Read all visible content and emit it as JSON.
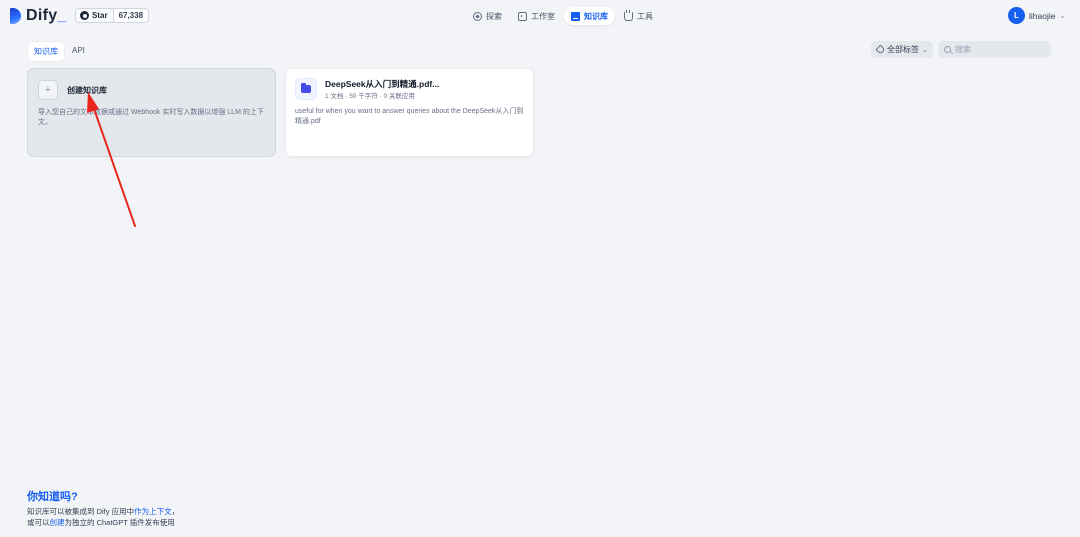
{
  "header": {
    "brand": "Dify",
    "brand_suffix": "_",
    "github": {
      "label": "Star",
      "count": "67,338"
    },
    "nav": [
      {
        "label": "探索",
        "icon": "compass-icon",
        "active": false
      },
      {
        "label": "工作室",
        "icon": "robot-icon",
        "active": false
      },
      {
        "label": "知识库",
        "icon": "book-icon",
        "active": true
      },
      {
        "label": "工具",
        "icon": "toolbox-icon",
        "active": false
      }
    ],
    "user": {
      "initial": "L",
      "name": "lihaojie"
    }
  },
  "toolbar": {
    "tabs": [
      {
        "label": "知识库",
        "active": true
      },
      {
        "label": "API",
        "active": false
      }
    ],
    "tag_filter": "全部标签",
    "search_placeholder": "搜索"
  },
  "create_card": {
    "title": "创建知识库",
    "description": "导入您自己的文本数据或通过 Webhook 实时写入数据以增强 LLM 的上下文。"
  },
  "datasets": [
    {
      "title": "DeepSeek从入门到精通.pdf...",
      "meta": "1 文档 · 50 千字符 · 0 关联应用",
      "description": "useful for when you want to answer queries about the DeepSeek从入门到精通.pdf"
    }
  ],
  "tips": {
    "title": "你知道吗?",
    "line1_prefix": "知识库可以被集成到 Dify 应用中",
    "line1_link": "作为上下文",
    "line1_suffix": "，",
    "line2_prefix": "或可以",
    "line2_link": "创建",
    "line2_suffix": "为独立的 ChatGPT 插件发布使用"
  },
  "colors": {
    "accent": "#155eef",
    "arrow": "#e8261e",
    "background": "#f2f4f7"
  }
}
